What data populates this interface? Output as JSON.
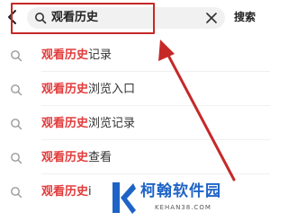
{
  "search": {
    "query": "观看历史",
    "submit_label": "搜索"
  },
  "icons": {
    "back": "chevron-left-icon",
    "search": "search-icon",
    "clear": "close-icon",
    "suggestion": "search-icon"
  },
  "suggestions": [
    {
      "highlight": "观看历史",
      "rest": "记录"
    },
    {
      "highlight": "观看历史",
      "rest": "浏览入口"
    },
    {
      "highlight": "观看历史",
      "rest": "浏览记录"
    },
    {
      "highlight": "观看历史",
      "rest": "查看"
    },
    {
      "highlight": "观看历史",
      "rest": "i"
    }
  ],
  "annotation": {
    "color": "#c62828"
  },
  "watermark": {
    "name": "柯翰软件园",
    "url": "KEHAN38.COM"
  },
  "colors": {
    "highlight_text": "#e23b3b",
    "watermark_blue": "#1e63c6"
  }
}
